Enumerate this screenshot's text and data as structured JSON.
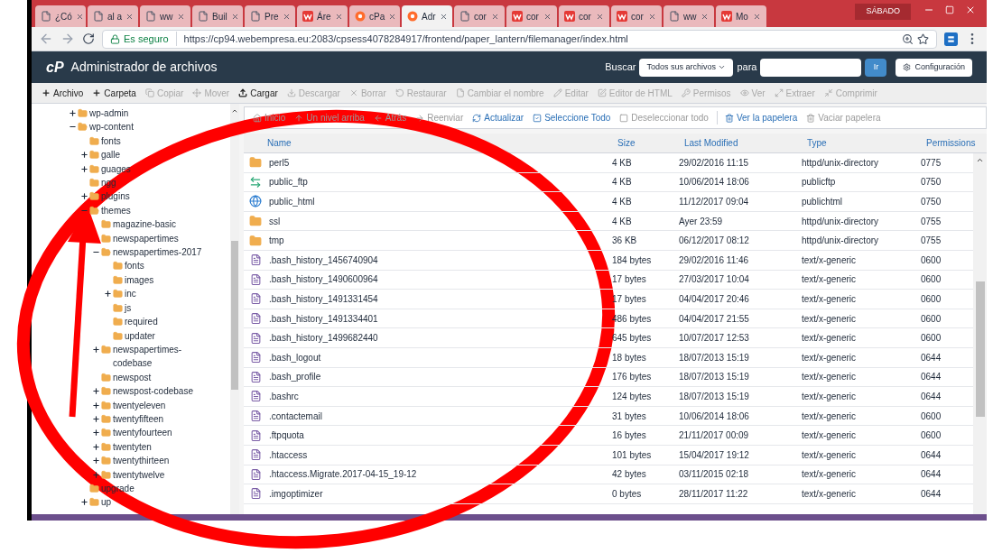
{
  "browser": {
    "tabs": [
      {
        "kind": "doc",
        "title": "¿Có",
        "selected": false
      },
      {
        "kind": "doc",
        "title": "al a",
        "selected": false
      },
      {
        "kind": "doc",
        "title": "ww",
        "selected": false
      },
      {
        "kind": "doc",
        "title": "Buil",
        "selected": false
      },
      {
        "kind": "doc",
        "title": "Pre",
        "selected": false
      },
      {
        "kind": "w",
        "title": "Áre",
        "selected": false
      },
      {
        "kind": "cp",
        "title": "cPa",
        "selected": false
      },
      {
        "kind": "cp",
        "title": "Adr",
        "selected": true
      },
      {
        "kind": "doc",
        "title": "cor",
        "selected": false
      },
      {
        "kind": "w",
        "title": "cor",
        "selected": false
      },
      {
        "kind": "w",
        "title": "cor",
        "selected": false
      },
      {
        "kind": "w",
        "title": "cor",
        "selected": false
      },
      {
        "kind": "doc",
        "title": "ww",
        "selected": false
      },
      {
        "kind": "w",
        "title": "Mo",
        "selected": false
      }
    ],
    "user_label": "SÁBADO",
    "secure_label": "Es seguro",
    "url": "https://cp94.webempresa.eu:2083/cpsess4078284917/frontend/paper_lantern/filemanager/index.html"
  },
  "header": {
    "logo": "cP",
    "title": "Administrador de archivos",
    "search_label": "Buscar",
    "search_scope": "Todos sus archivos",
    "for_label": "para",
    "go_button": "Ir",
    "settings_button": "Configuración"
  },
  "toolbar": [
    {
      "label": "Archivo",
      "disabled": false
    },
    {
      "label": "Carpeta",
      "disabled": false
    },
    {
      "label": "Copiar",
      "disabled": true
    },
    {
      "label": "Mover",
      "disabled": true
    },
    {
      "label": "Cargar",
      "disabled": false
    },
    {
      "label": "Descargar",
      "disabled": true
    },
    {
      "label": "Borrar",
      "disabled": true
    },
    {
      "label": "Restaurar",
      "disabled": true
    },
    {
      "label": "Cambiar el nombre",
      "disabled": true
    },
    {
      "label": "Editar",
      "disabled": true
    },
    {
      "label": "Editor de HTML",
      "disabled": true
    },
    {
      "label": "Permisos",
      "disabled": true
    },
    {
      "label": "Ver",
      "disabled": true
    },
    {
      "label": "Extraer",
      "disabled": true
    },
    {
      "label": "Comprimir",
      "disabled": true
    }
  ],
  "tree": [
    {
      "name": "wp-admin",
      "expanded": false
    },
    {
      "name": "wp-content",
      "expanded": true,
      "children": [
        {
          "name": "fonts"
        },
        {
          "name": "galle",
          "expanded": false
        },
        {
          "name": "guages",
          "expanded": false
        },
        {
          "name": "ngg"
        },
        {
          "name": "plugins",
          "expanded": false
        },
        {
          "name": "themes",
          "expanded": true,
          "children": [
            {
              "name": "magazine-basic"
            },
            {
              "name": "newspapertimes"
            },
            {
              "name": "newspapertimes-2017",
              "expanded": true,
              "children": [
                {
                  "name": "fonts"
                },
                {
                  "name": "images"
                },
                {
                  "name": "inc",
                  "expanded": false
                },
                {
                  "name": "js"
                },
                {
                  "name": "required"
                },
                {
                  "name": "updater"
                }
              ]
            },
            {
              "name": "newspapertimes-codebase",
              "expanded": false
            },
            {
              "name": "newspost"
            },
            {
              "name": "newspost-codebase",
              "expanded": false
            },
            {
              "name": "twentyeleven",
              "expanded": false
            },
            {
              "name": "twentyfifteen",
              "expanded": false
            },
            {
              "name": "twentyfourteen",
              "expanded": false
            },
            {
              "name": "twentyten",
              "expanded": false
            },
            {
              "name": "twentythirteen",
              "expanded": false
            },
            {
              "name": "twentytwelve",
              "expanded": false
            }
          ]
        },
        {
          "name": "upgrade"
        },
        {
          "name": "up",
          "expanded": false
        }
      ]
    }
  ],
  "nav": [
    {
      "label": "Inicio",
      "disabled": true
    },
    {
      "label": "Un nivel arriba",
      "disabled": true
    },
    {
      "label": "Atrás",
      "disabled": true
    },
    {
      "label": "Reenviar",
      "disabled": true
    },
    {
      "label": "Actualizar",
      "disabled": false
    },
    {
      "label": "Seleccione Todo",
      "disabled": false
    },
    {
      "label": "Deseleccionar todo",
      "disabled": true
    },
    {
      "label": "Ver la papelera",
      "disabled": false
    },
    {
      "label": "Vaciar papelera",
      "disabled": true
    }
  ],
  "table": {
    "columns": [
      "Name",
      "Size",
      "Last Modified",
      "Type",
      "Permissions"
    ],
    "rows": [
      {
        "kind": "folder",
        "name": "perl5",
        "size": "4 KB",
        "modified": "29/02/2016 11:15",
        "type": "httpd/unix-directory",
        "perms": "0775"
      },
      {
        "kind": "ftp",
        "name": "public_ftp",
        "size": "4 KB",
        "modified": "10/06/2014 18:06",
        "type": "publicftp",
        "perms": "0750"
      },
      {
        "kind": "web",
        "name": "public_html",
        "size": "4 KB",
        "modified": "11/12/2017 09:04",
        "type": "publichtml",
        "perms": "0750"
      },
      {
        "kind": "folder",
        "name": "ssl",
        "size": "4 KB",
        "modified": "Ayer 23:59",
        "type": "httpd/unix-directory",
        "perms": "0755"
      },
      {
        "kind": "folder",
        "name": "tmp",
        "size": "36 KB",
        "modified": "06/12/2017 08:12",
        "type": "httpd/unix-directory",
        "perms": "0755"
      },
      {
        "kind": "file",
        "name": ".bash_history_1456740904",
        "size": "184 bytes",
        "modified": "29/02/2016 11:46",
        "type": "text/x-generic",
        "perms": "0600"
      },
      {
        "kind": "file",
        "name": ".bash_history_1490600964",
        "size": "17 bytes",
        "modified": "27/03/2017 10:04",
        "type": "text/x-generic",
        "perms": "0600"
      },
      {
        "kind": "file",
        "name": ".bash_history_1491331454",
        "size": "17 bytes",
        "modified": "04/04/2017 20:46",
        "type": "text/x-generic",
        "perms": "0600"
      },
      {
        "kind": "file",
        "name": ".bash_history_1491334401",
        "size": "486 bytes",
        "modified": "04/04/2017 21:55",
        "type": "text/x-generic",
        "perms": "0600"
      },
      {
        "kind": "file",
        "name": ".bash_history_1499682440",
        "size": "645 bytes",
        "modified": "10/07/2017 12:53",
        "type": "text/x-generic",
        "perms": "0600"
      },
      {
        "kind": "file",
        "name": ".bash_logout",
        "size": "18 bytes",
        "modified": "18/07/2013 15:19",
        "type": "text/x-generic",
        "perms": "0644"
      },
      {
        "kind": "file",
        "name": ".bash_profile",
        "size": "176 bytes",
        "modified": "18/07/2013 15:19",
        "type": "text/x-generic",
        "perms": "0644"
      },
      {
        "kind": "file",
        "name": ".bashrc",
        "size": "124 bytes",
        "modified": "18/07/2013 15:19",
        "type": "text/x-generic",
        "perms": "0644"
      },
      {
        "kind": "file",
        "name": ".contactemail",
        "size": "31 bytes",
        "modified": "10/06/2014 18:06",
        "type": "text/x-generic",
        "perms": "0600"
      },
      {
        "kind": "file",
        "name": ".ftpquota",
        "size": "16 bytes",
        "modified": "21/11/2017 00:09",
        "type": "text/x-generic",
        "perms": "0600"
      },
      {
        "kind": "file",
        "name": ".htaccess",
        "size": "101 bytes",
        "modified": "15/04/2017 19:12",
        "type": "text/x-generic",
        "perms": "0644"
      },
      {
        "kind": "file",
        "name": ".htaccess.Migrate.2017-04-15_19-12",
        "size": "42 bytes",
        "modified": "03/11/2015 02:18",
        "type": "text/x-generic",
        "perms": "0644"
      },
      {
        "kind": "file",
        "name": ".imgoptimizer",
        "size": "0 bytes",
        "modified": "28/11/2017 11:22",
        "type": "text/x-generic",
        "perms": "0644"
      }
    ]
  }
}
